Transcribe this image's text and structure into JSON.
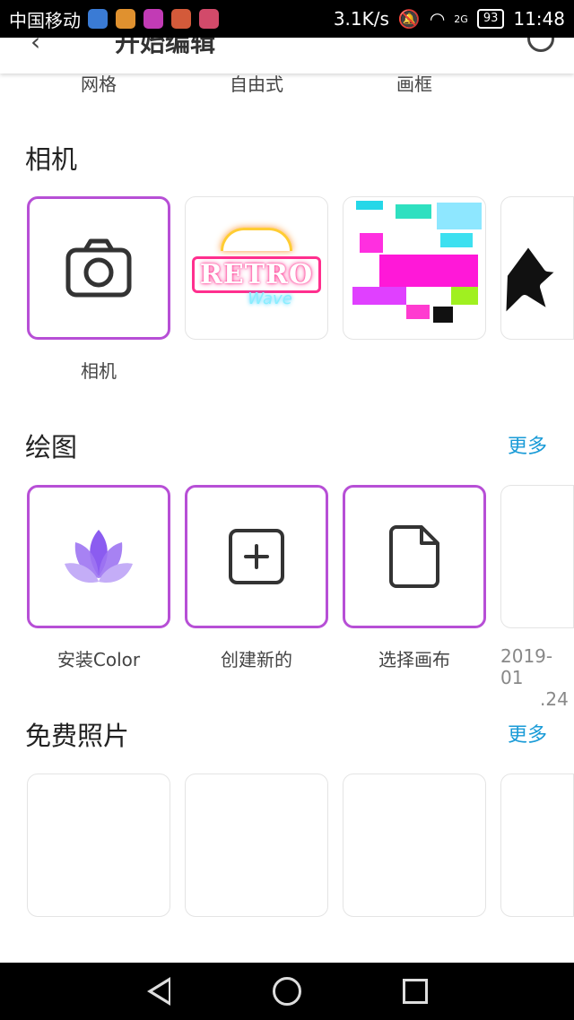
{
  "status_bar": {
    "carrier": "中国移动",
    "speed": "3.1K/s",
    "network": "2G",
    "battery": "93",
    "time": "11:48"
  },
  "header": {
    "title": "开始编辑"
  },
  "top_row": [
    "网格",
    "自由式",
    "画框"
  ],
  "sections": {
    "camera": {
      "title": "相机",
      "tiles": [
        {
          "label": "相机",
          "icon": "camera-icon"
        },
        {
          "label": "",
          "thumb_text_1": "RETRO",
          "thumb_text_2": "Wave"
        },
        {
          "label": ""
        },
        {
          "label": ""
        }
      ]
    },
    "drawing": {
      "title": "绘图",
      "more": "更多",
      "tiles": [
        {
          "label": "安装Color",
          "icon": "lotus-icon"
        },
        {
          "label": "创建新的",
          "icon": "plus-square-icon"
        },
        {
          "label": "选择画布",
          "icon": "document-icon"
        },
        {
          "label_line1": "2019-01",
          "label_line2": ".24"
        }
      ]
    },
    "photos": {
      "title": "免费照片",
      "more": "更多"
    }
  },
  "colors": {
    "accent_border": "#b74fd6",
    "link": "#1a9bd7"
  }
}
